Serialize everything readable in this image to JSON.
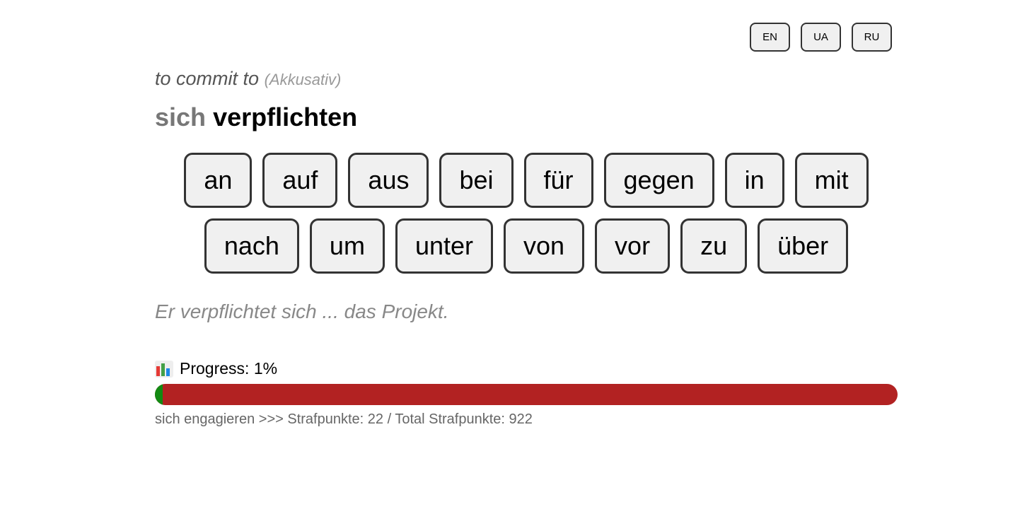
{
  "languages": [
    "EN",
    "UA",
    "RU"
  ],
  "translation": "to commit to",
  "case_hint": "(Akkusativ)",
  "verb": {
    "reflexive": "sich",
    "main": "verpflichten"
  },
  "prepositions_row1": [
    "an",
    "auf",
    "aus",
    "bei",
    "für",
    "gegen",
    "in",
    "mit"
  ],
  "prepositions_row2": [
    "nach",
    "um",
    "unter",
    "von",
    "vor",
    "zu",
    "über"
  ],
  "example": "Er verpflichtet sich ... das Projekt.",
  "progress": {
    "icon": "bar-chart-icon",
    "label": "Progress: 1%",
    "value": 0.01
  },
  "status": "sich engagieren >>> Strafpunkte: 22 / Total Strafpunkte: 922",
  "colors": {
    "progress_fill": "#128a12",
    "progress_track": "#b22222"
  }
}
